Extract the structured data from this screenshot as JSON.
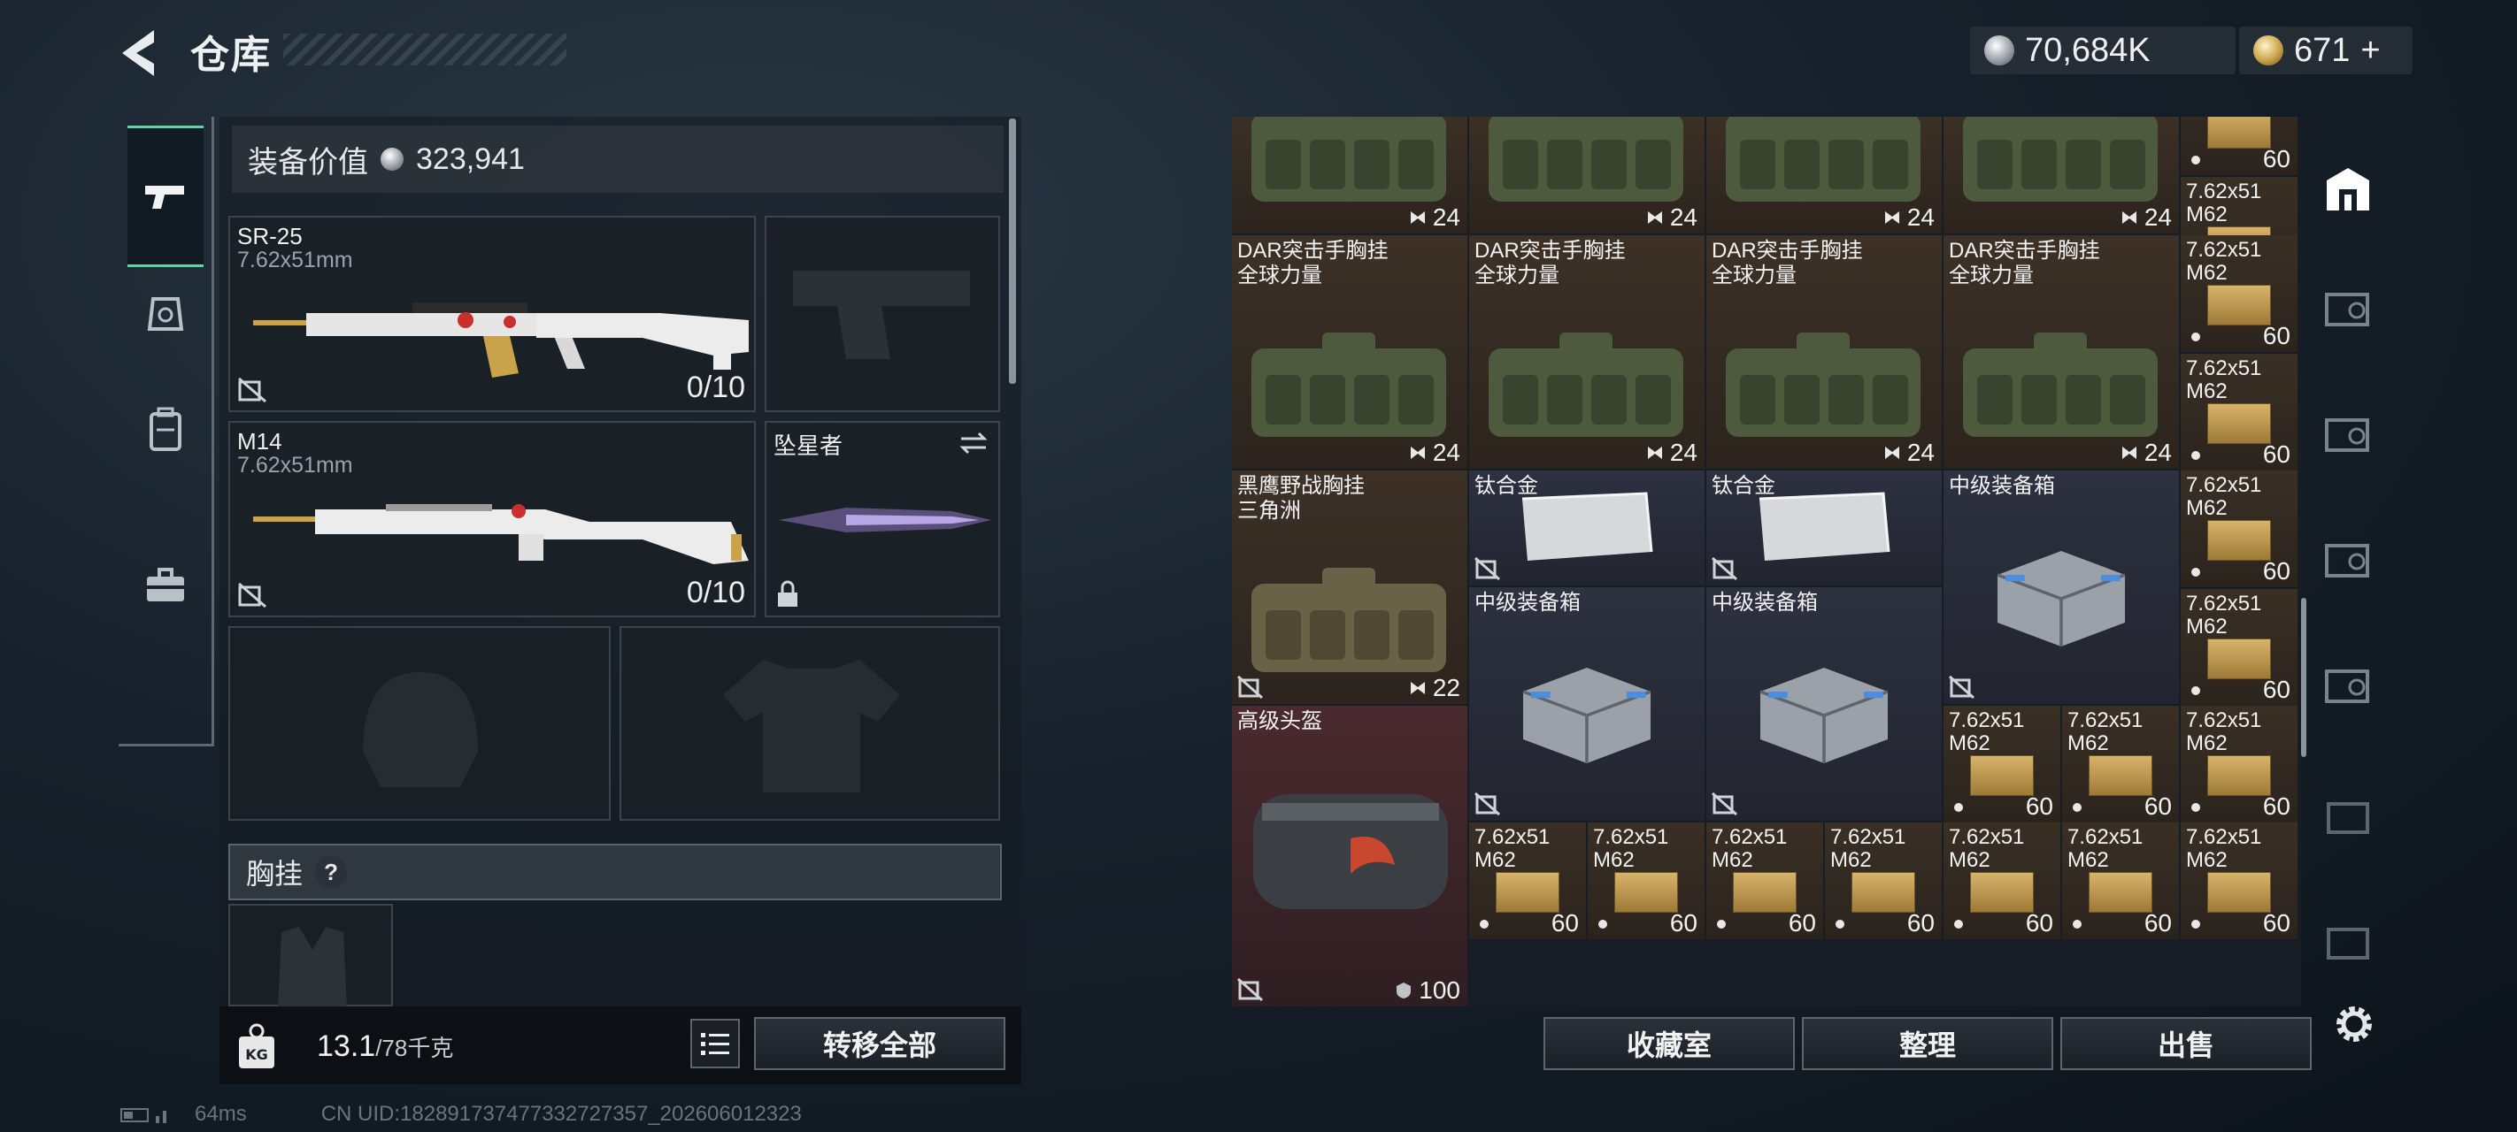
{
  "header": {
    "title": "仓库",
    "currency_silver": "70,684K",
    "currency_gold": "671",
    "currency_gold_plus": "+"
  },
  "equipment": {
    "value_label": "装备价值",
    "value": "323,941",
    "primary1": {
      "name": "SR-25",
      "caliber": "7.62x51mm",
      "mag": "0/10"
    },
    "primary2": {
      "name": "M14",
      "caliber": "7.62x51mm",
      "mag": "0/10"
    },
    "melee": {
      "name": "坠星者"
    },
    "chest_rig_label": "胸挂",
    "chest_rig_help": "?",
    "weight_current": "13.1",
    "weight_max": "/78千克",
    "transfer_all": "转移全部"
  },
  "stash": {
    "dar_line1": "DAR突击手胸挂",
    "dar_line2": "全球力量",
    "blackhawk_line1": "黑鹰野战胸挂",
    "blackhawk_line2": "三角洲",
    "titanium": "钛合金",
    "mid_box": "中级装备箱",
    "helmet": "高级头盔",
    "ammo_line1": "7.62x51",
    "ammo_line2": "M62",
    "qty_24": "24",
    "qty_22": "22",
    "qty_60": "60",
    "qty_100": "100"
  },
  "bottom_buttons": {
    "collection": "收藏室",
    "organize": "整理",
    "sell": "出售"
  },
  "status": {
    "ping": "64ms",
    "uid": "CN UID:1828917374773327273​57_202606012323"
  },
  "colors": {
    "accent": "#5fd3a4",
    "olive_cell": "#3d3127",
    "steel_cell": "#2d3140",
    "red_cell": "#4a2a2e"
  }
}
